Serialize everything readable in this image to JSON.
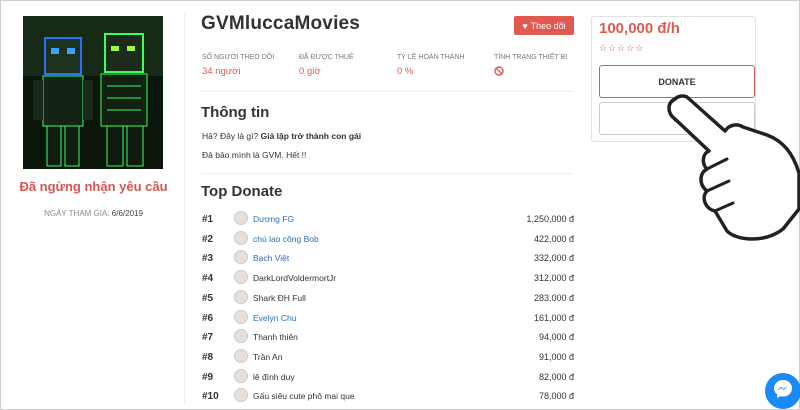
{
  "profile": {
    "name": "GVMluccaMovies",
    "follow_label": "Theo dõi",
    "status": "Đã ngừng nhận yêu cầu",
    "join_label": "NGÀY THAM GIA:",
    "join_date": "6/6/2019"
  },
  "stats": [
    {
      "label": "SỐ NGƯỜI THEO DÕI",
      "value": "34 người"
    },
    {
      "label": "ĐÃ ĐƯỢC THUÊ",
      "value": "0 giờ"
    },
    {
      "label": "TỶ LỆ HOÀN THÀNH",
      "value": "0 %"
    },
    {
      "label": "TÌNH TRẠNG THIẾT BỊ",
      "value_icon": "ban-icon"
    }
  ],
  "info": {
    "title": "Thông tin",
    "line1_prefix": "Hả? Đây là gì?",
    "line1_bold": "Giả lập trở thành con gái",
    "line2": "Đả bảo mình là GVM. Hết !!"
  },
  "top_donate": {
    "title": "Top Donate",
    "rows": [
      {
        "rank": "#1",
        "name": "Dương FG",
        "amount": "1,250,000 đ",
        "link": true
      },
      {
        "rank": "#2",
        "name": "chú lao công Bob",
        "amount": "422,000 đ",
        "link": true
      },
      {
        "rank": "#3",
        "name": "Bạch Việt",
        "amount": "332,000 đ",
        "link": true
      },
      {
        "rank": "#4",
        "name": "DarkLordVoldermortJr",
        "amount": "312,000 đ",
        "link": false
      },
      {
        "rank": "#5",
        "name": "Shark ĐH Full",
        "amount": "283,000 đ",
        "link": false
      },
      {
        "rank": "#6",
        "name": "Evelyn Chu",
        "amount": "161,000 đ",
        "link": true
      },
      {
        "rank": "#7",
        "name": "Thanh thiên",
        "amount": "94,000 đ",
        "link": false
      },
      {
        "rank": "#8",
        "name": "Trần An",
        "amount": "91,000 đ",
        "link": false
      },
      {
        "rank": "#9",
        "name": "lê đình duy",
        "amount": "82,000 đ",
        "link": false
      },
      {
        "rank": "#10",
        "name": "Gấu siêu cute phô mai que",
        "amount": "78,000 đ",
        "link": false
      }
    ]
  },
  "sidebar": {
    "price": "100,000 đ/h",
    "rating": 0,
    "stars_max": 5,
    "donate_label": "DONATE",
    "chat_icon": "chat-icon"
  },
  "colors": {
    "accent": "#e05a52",
    "link": "#2a6eb3",
    "messenger": "#1a8bf6"
  }
}
